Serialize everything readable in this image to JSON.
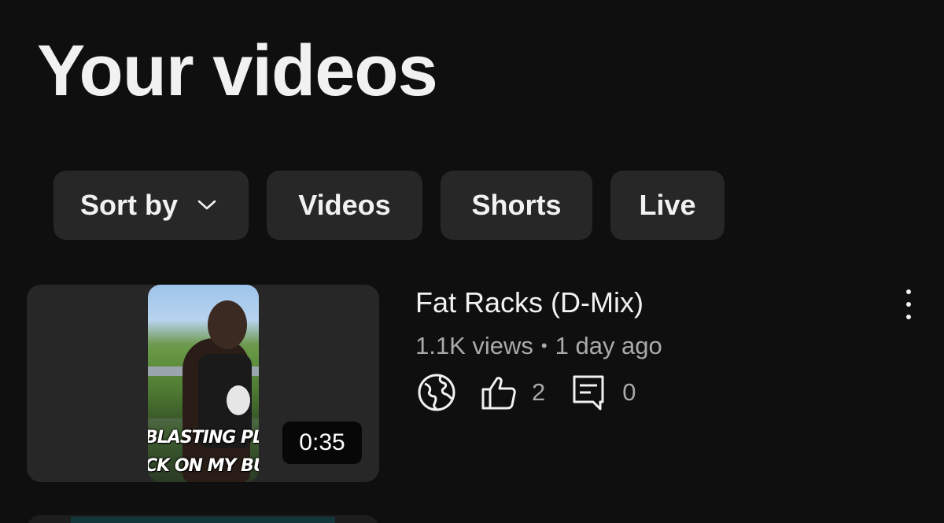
{
  "page": {
    "title": "Your videos"
  },
  "filters": {
    "sort_label": "Sort by",
    "chips": [
      "Videos",
      "Shorts",
      "Live"
    ]
  },
  "videos": [
    {
      "title": "Fat Racks (D-Mix)",
      "views": "1.1K views",
      "separator": "•",
      "age": "1 day ago",
      "duration": "0:35",
      "visibility_icon": "globe-icon",
      "likes": "2",
      "comments": "0",
      "thumbnail_caption_line1": "BLASTING PLA",
      "thumbnail_caption_line2": "CK ON MY BU"
    }
  ],
  "colors": {
    "background": "#0f0f0f",
    "chip_background": "#272727",
    "primary_text": "#f1f1f1",
    "secondary_text": "#aaaaaa"
  }
}
